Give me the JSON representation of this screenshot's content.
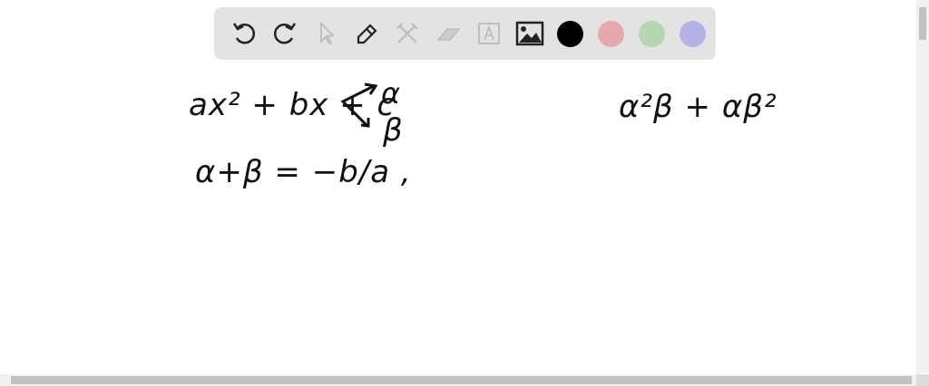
{
  "toolbar": {
    "tools": [
      "undo-icon",
      "redo-icon",
      "select-icon",
      "pen-icon",
      "tools-icon",
      "eraser-icon",
      "text-icon",
      "image-icon"
    ],
    "colors": [
      "#000000",
      "#e6a8ad",
      "#b5d6b1",
      "#b4b2e6"
    ]
  },
  "canvas": {
    "quadratic": "ax² + bx + c",
    "roots_alpha": "α",
    "roots_beta": "β",
    "sum": "α+β = −b/a ,",
    "expression": "α²β + αβ²"
  }
}
